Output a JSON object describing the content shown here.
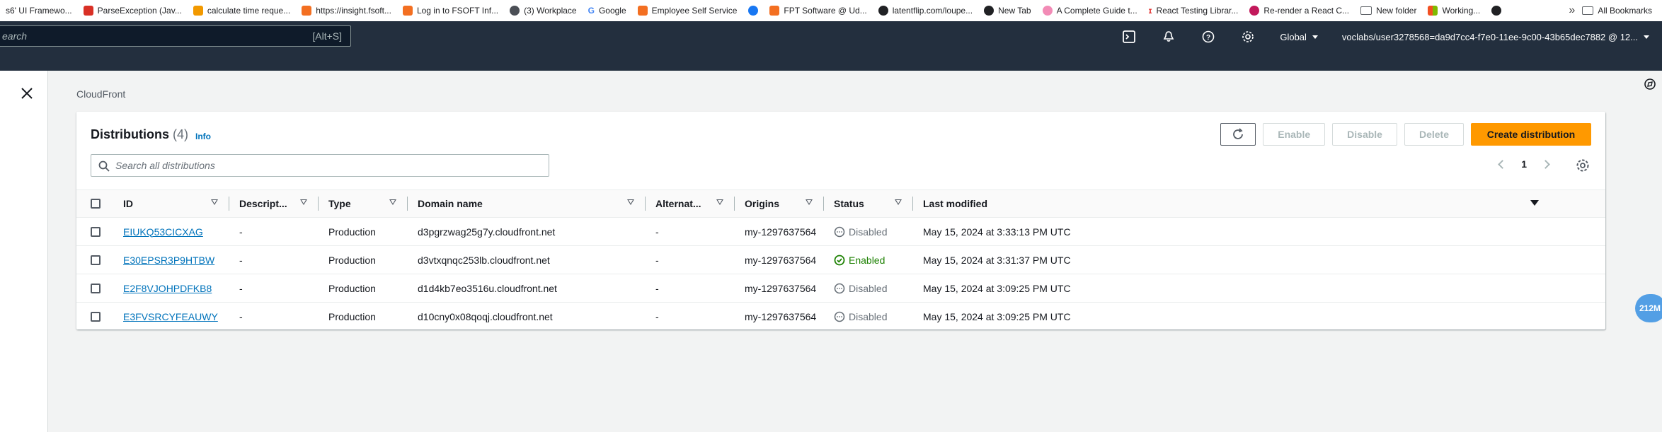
{
  "bookmarks": [
    {
      "label": "s6' UI Framewo...",
      "icon": "bookmark-favicon",
      "color": "#7b3fe4"
    },
    {
      "label": "ParseException (Jav...",
      "icon": "mail-icon",
      "color": "#d93025"
    },
    {
      "label": "calculate time reque...",
      "icon": "pencil-icon",
      "color": "#f29900"
    },
    {
      "label": "https://insight.fsoft...",
      "icon": "fsoft-icon",
      "color": "#f36f21"
    },
    {
      "label": "Log in to FSOFT Inf...",
      "icon": "fsoft-icon",
      "color": "#f36f21"
    },
    {
      "label": "(3) Workplace",
      "icon": "workplace-icon",
      "color": "#4b4f56"
    },
    {
      "label": "Google",
      "icon": "google-icon",
      "color": "#4285f4"
    },
    {
      "label": "Employee Self Service",
      "icon": "fsoft-icon",
      "color": "#f36f21"
    },
    {
      "label": "",
      "icon": "facebook-icon",
      "color": "#1877f2"
    },
    {
      "label": "FPT Software @ Ud...",
      "icon": "fsoft-icon",
      "color": "#f36f21"
    },
    {
      "label": "latentflip.com/loupe...",
      "icon": "globe-icon",
      "color": "#202124"
    },
    {
      "label": "New Tab",
      "icon": "globe-icon",
      "color": "#202124"
    },
    {
      "label": "A Complete Guide t...",
      "icon": "guide-icon",
      "color": "#f28bb6"
    },
    {
      "label": "React Testing Librar...",
      "icon": "react-testing-icon",
      "color": "#e33332"
    },
    {
      "label": "Re-render a React C...",
      "icon": "rerender-icon",
      "color": "#c2185b"
    },
    {
      "label": "New folder",
      "icon": "folder-icon",
      "color": "#5f6368"
    },
    {
      "label": "Working...",
      "icon": "microsoft-icon",
      "color": "#f25022"
    },
    {
      "label": "",
      "icon": "globe-icon",
      "color": "#202124"
    }
  ],
  "bookmarks_more": "»",
  "all_bookmarks": "All Bookmarks",
  "header": {
    "search_placeholder": "earch",
    "search_shortcut": "[Alt+S]",
    "region": "Global",
    "account": "voclabs/user3278568=da9d7cc4-f7e0-11ee-9c00-43b65dec7882 @ 12..."
  },
  "breadcrumb": "CloudFront",
  "panel": {
    "title": "Distributions",
    "count": "(4)",
    "info": "Info",
    "buttons": {
      "enable": "Enable",
      "disable": "Disable",
      "delete": "Delete",
      "create": "Create distribution"
    },
    "filter_placeholder": "Search all distributions",
    "page": "1"
  },
  "columns": [
    "ID",
    "Descript...",
    "Type",
    "Domain name",
    "Alternat...",
    "Origins",
    "Status",
    "Last modified"
  ],
  "rows": [
    {
      "id": "EIUKQ53CICXAG",
      "desc": "-",
      "type": "Production",
      "domain": "d3pgrzwag25g7y.cloudfront.net",
      "alt": "-",
      "origins": "my-1297637564",
      "status": "Disabled",
      "modified": "May 15, 2024 at 3:33:13 PM UTC"
    },
    {
      "id": "E30EPSR3P9HTBW",
      "desc": "-",
      "type": "Production",
      "domain": "d3vtxqnqc253lb.cloudfront.net",
      "alt": "-",
      "origins": "my-1297637564",
      "status": "Enabled",
      "modified": "May 15, 2024 at 3:31:37 PM UTC"
    },
    {
      "id": "E2F8VJOHPDFKB8",
      "desc": "-",
      "type": "Production",
      "domain": "d1d4kb7eo3516u.cloudfront.net",
      "alt": "-",
      "origins": "my-1297637564",
      "status": "Disabled",
      "modified": "May 15, 2024 at 3:09:25 PM UTC"
    },
    {
      "id": "E3FVSRCYFEAUWY",
      "desc": "-",
      "type": "Production",
      "domain": "d10cny0x08qoqj.cloudfront.net",
      "alt": "-",
      "origins": "my-1297637564",
      "status": "Disabled",
      "modified": "May 15, 2024 at 3:09:25 PM UTC"
    }
  ],
  "bubble": "212M"
}
